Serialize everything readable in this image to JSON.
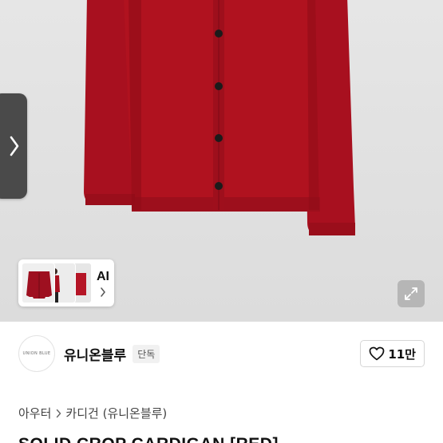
{
  "gallery": {
    "ai_label": "AI",
    "colors": {
      "garment": "#a8101f",
      "garment_shadow": "#860b18",
      "button": "#1b1b1b"
    }
  },
  "brand": {
    "logo_text": "UNION BLUE",
    "name": "유니온블루",
    "badge": "단독",
    "like_count": "11만"
  },
  "breadcrumb": {
    "items": [
      "아우터",
      "카디건 (유니온블루)"
    ]
  },
  "product": {
    "title": "SOLID CROP CARDIGAN [RED]"
  }
}
